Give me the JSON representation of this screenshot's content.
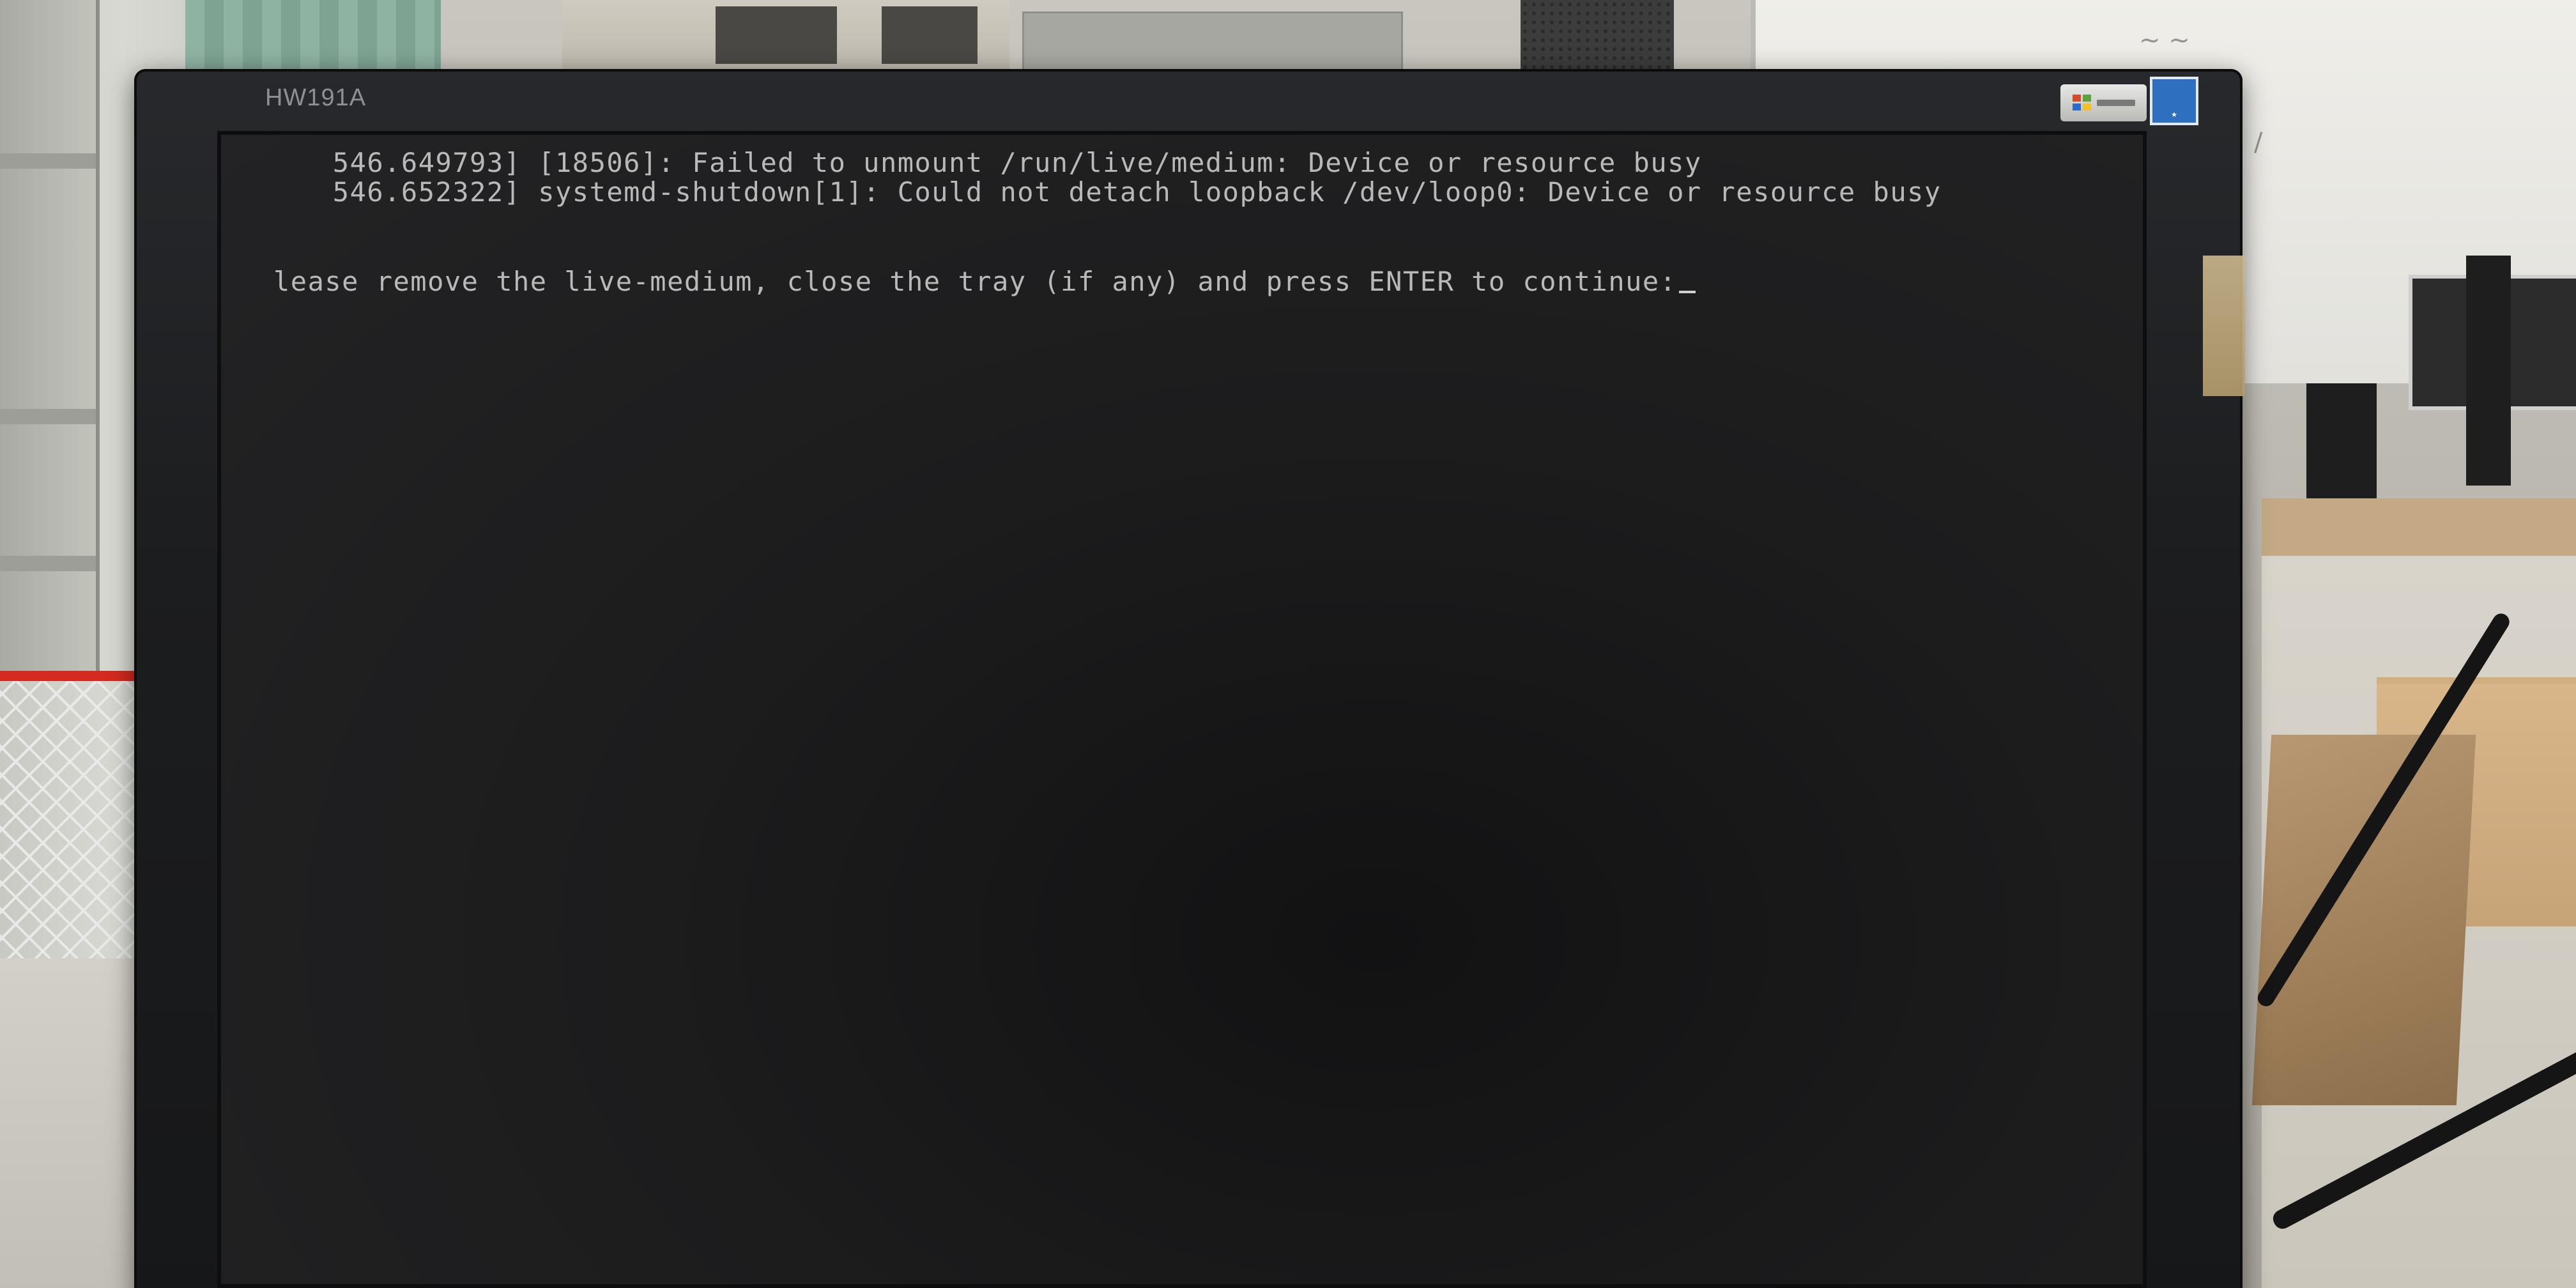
{
  "monitor": {
    "model_label": "HW191A",
    "stickers": {
      "windows": "windows-logo-icon",
      "energy_star": "energy-star-icon"
    }
  },
  "console": {
    "lines": [
      {
        "text": " 546.649793] [18506]: Failed to unmount /run/live/medium: Device or resource busy"
      },
      {
        "text": " 546.652322] systemd-shutdown[1]: Could not detach loopback /dev/loop0: Device or resource busy"
      }
    ],
    "prompt": "lease remove the live-medium, close the tray (if any) and press ENTER to continue:",
    "cursor": "_"
  },
  "colors": {
    "console_text": "#b9b9b9",
    "screen_bg": "#1c1c1d",
    "bezel": "#1c1d1f",
    "basket_red": "#d42a20",
    "energy_star_blue": "#2f6fbf"
  }
}
